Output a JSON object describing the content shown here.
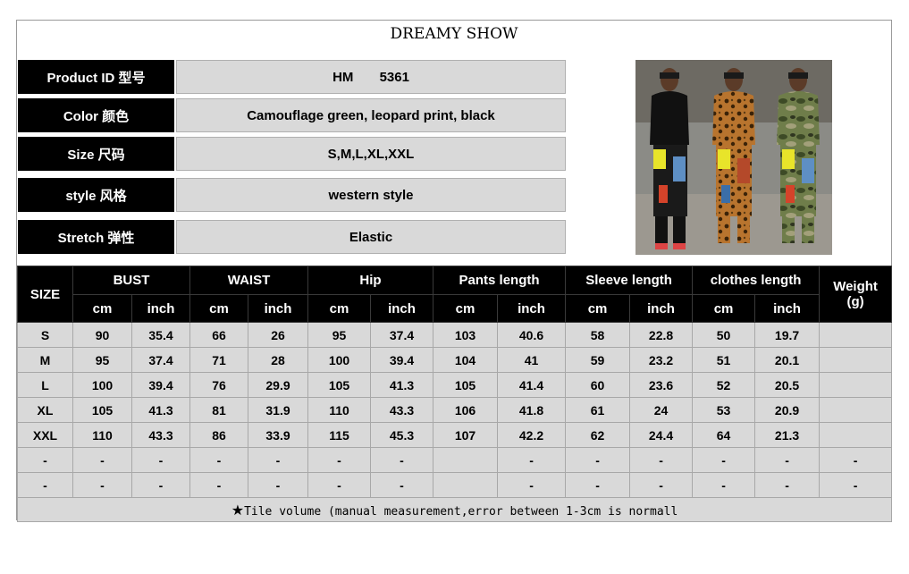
{
  "brand": "DREAMY SHOW",
  "info": [
    {
      "label": "Product ID 型号",
      "value": "HM       5361"
    },
    {
      "label": "Color 颜色",
      "value": "Camouflage green, leopard print, black"
    },
    {
      "label": "Size 尺码",
      "value": "S,M,L,XL,XXL"
    },
    {
      "label": "style 风格",
      "value": "western style"
    },
    {
      "label": "Stretch 弹性",
      "value": "Elastic"
    }
  ],
  "photo": {
    "panels": [
      "black",
      "leopard",
      "camouflage"
    ]
  },
  "table": {
    "size_label": "SIZE",
    "groups": [
      "BUST",
      "WAIST",
      "Hip",
      "Pants length",
      "Sleeve length",
      "clothes length"
    ],
    "weight_label": "Weight",
    "weight_unit": "(g)",
    "units": [
      "cm",
      "inch"
    ],
    "rows": [
      {
        "size": "S",
        "values": [
          "90",
          "35.4",
          "66",
          "26",
          "95",
          "37.4",
          "103",
          "40.6",
          "58",
          "22.8",
          "50",
          "19.7"
        ],
        "weight": ""
      },
      {
        "size": "M",
        "values": [
          "95",
          "37.4",
          "71",
          "28",
          "100",
          "39.4",
          "104",
          "41",
          "59",
          "23.2",
          "51",
          "20.1"
        ],
        "weight": ""
      },
      {
        "size": "L",
        "values": [
          "100",
          "39.4",
          "76",
          "29.9",
          "105",
          "41.3",
          "105",
          "41.4",
          "60",
          "23.6",
          "52",
          "20.5"
        ],
        "weight": ""
      },
      {
        "size": "XL",
        "values": [
          "105",
          "41.3",
          "81",
          "31.9",
          "110",
          "43.3",
          "106",
          "41.8",
          "61",
          "24",
          "53",
          "20.9"
        ],
        "weight": ""
      },
      {
        "size": "XXL",
        "values": [
          "110",
          "43.3",
          "86",
          "33.9",
          "115",
          "45.3",
          "107",
          "42.2",
          "62",
          "24.4",
          "64",
          "21.3"
        ],
        "weight": ""
      },
      {
        "size": "-",
        "values": [
          "-",
          "-",
          "-",
          "-",
          "-",
          "-",
          "",
          "-",
          "-",
          "-",
          "-",
          "-"
        ],
        "weight": "-"
      },
      {
        "size": "-",
        "values": [
          "-",
          "-",
          "-",
          "-",
          "-",
          "-",
          "",
          "-",
          "-",
          "-",
          "-",
          "-"
        ],
        "weight": "-"
      }
    ],
    "footnote_star": "★",
    "footnote": "Tile volume (manual measurement,error between 1-3cm is normall"
  }
}
